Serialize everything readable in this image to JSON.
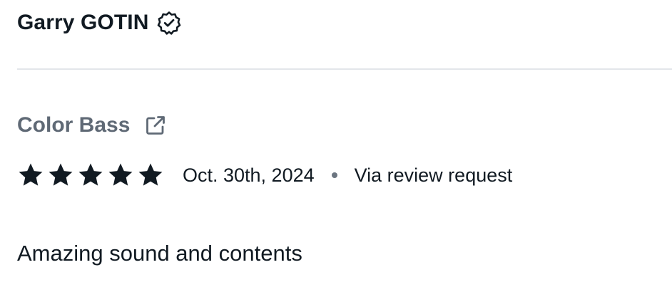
{
  "reviewer": {
    "name": "Garry GOTIN",
    "verified_icon": "verified-badge-icon"
  },
  "product": {
    "name": "Color Bass",
    "link_icon": "external-link-icon"
  },
  "review": {
    "rating": 5,
    "max_rating": 5,
    "date": "Oct. 30th, 2024",
    "source": "Via review request",
    "body": "Amazing sound and contents"
  },
  "colors": {
    "text": "#111a22",
    "muted_text": "#5f6975",
    "star": "#111a22",
    "divider": "#e3e6ea"
  }
}
